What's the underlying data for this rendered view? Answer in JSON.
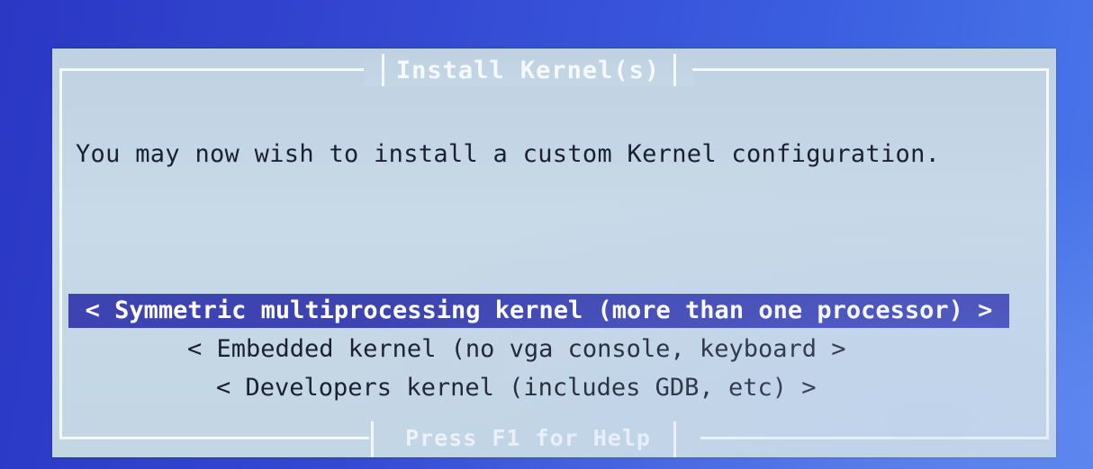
{
  "dialog": {
    "title": "Install Kernel(s)",
    "message": "You may now wish to install a custom Kernel configuration.",
    "options": [
      {
        "label": "< Symmetric multiprocessing kernel (more than one processor) >",
        "selected": true
      },
      {
        "label": "< Embedded kernel (no vga console, keyboard >",
        "selected": false
      },
      {
        "label": "< Developers kernel (includes GDB, etc) >",
        "selected": false
      }
    ],
    "help": "Press F1 for Help"
  },
  "colors": {
    "background": "#3448d2",
    "dialog": "#c3d6e4",
    "selection": "#3d44b2",
    "frame": "#f4f8fb"
  }
}
